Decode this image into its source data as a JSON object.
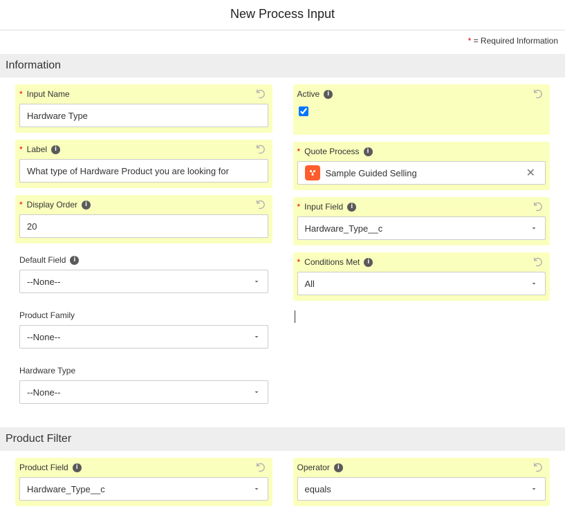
{
  "page": {
    "title": "New Process Input",
    "requiredInfo": "= Required Information"
  },
  "sections": {
    "information": {
      "title": "Information"
    },
    "productFilter": {
      "title": "Product Filter"
    }
  },
  "fields": {
    "inputName": {
      "label": "Input Name",
      "value": "Hardware Type",
      "required": true
    },
    "label": {
      "label": "Label",
      "value": "What type of Hardware Product you are looking for",
      "required": true
    },
    "displayOrder": {
      "label": "Display Order",
      "value": "20",
      "required": true
    },
    "defaultField": {
      "label": "Default Field",
      "value": "--None--"
    },
    "productFamily": {
      "label": "Product Family",
      "value": "--None--"
    },
    "hardwareType": {
      "label": "Hardware Type",
      "value": "--None--"
    },
    "active": {
      "label": "Active",
      "checked": true
    },
    "quoteProcess": {
      "label": "Quote Process",
      "value": "Sample Guided Selling",
      "required": true
    },
    "inputField": {
      "label": "Input Field",
      "value": "Hardware_Type__c",
      "required": true
    },
    "conditionsMet": {
      "label": "Conditions Met",
      "value": "All",
      "required": true
    },
    "productField": {
      "label": "Product Field",
      "value": "Hardware_Type__c"
    },
    "operator": {
      "label": "Operator",
      "value": "equals"
    }
  }
}
